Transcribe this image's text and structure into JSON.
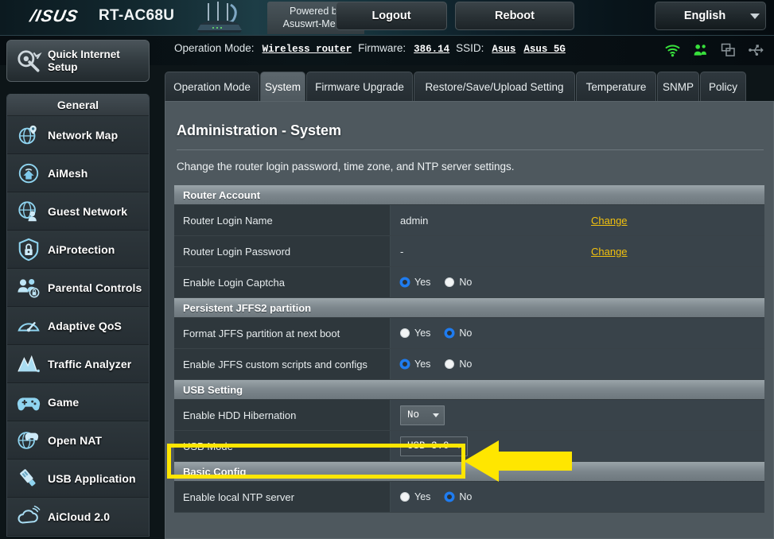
{
  "banner": {
    "brand": "/ISUS",
    "model": "RT-AC68U",
    "powered_line1": "Powered by",
    "powered_line2": "Asuswrt-Merlin",
    "logout_label": "Logout",
    "reboot_label": "Reboot",
    "language": "English",
    "router_image": "router-illustration"
  },
  "statusbar": {
    "op_mode_label": "Operation Mode:",
    "op_mode_value": "Wireless router",
    "firmware_label": "Firmware:",
    "firmware_value": "386.14",
    "ssid_label": "SSID:",
    "ssid_value_1": "Asus",
    "ssid_value_2": "Asus_5G",
    "icons": [
      {
        "name": "wifi-icon",
        "color": "#38e03c"
      },
      {
        "name": "clients-icon",
        "color": "#38e03c"
      },
      {
        "name": "windows-icon",
        "color": "#8a9499"
      },
      {
        "name": "usb-icon",
        "color": "#8a9499"
      }
    ]
  },
  "sidebar": {
    "qis_label": "Quick Internet Setup",
    "general_label": "General",
    "items": [
      {
        "label": "Network Map",
        "icon": "network-map-icon"
      },
      {
        "label": "AiMesh",
        "icon": "aimesh-icon"
      },
      {
        "label": "Guest Network",
        "icon": "guest-network-icon"
      },
      {
        "label": "AiProtection",
        "icon": "aiprotection-shield-icon"
      },
      {
        "label": "Parental Controls",
        "icon": "parental-controls-icon"
      },
      {
        "label": "Adaptive QoS",
        "icon": "adaptive-qos-icon"
      },
      {
        "label": "Traffic Analyzer",
        "icon": "traffic-analyzer-icon"
      },
      {
        "label": "Game",
        "icon": "gamepad-icon"
      },
      {
        "label": "Open NAT",
        "icon": "open-nat-icon"
      },
      {
        "label": "USB Application",
        "icon": "usb-application-icon"
      },
      {
        "label": "AiCloud 2.0",
        "icon": "aicloud-icon"
      }
    ]
  },
  "tabs": [
    {
      "label": "Operation Mode",
      "active": false
    },
    {
      "label": "System",
      "active": true
    },
    {
      "label": "Firmware Upgrade",
      "active": false
    },
    {
      "label": "Restore/Save/Upload Setting",
      "active": false
    },
    {
      "label": "Temperature",
      "active": false
    },
    {
      "label": "SNMP",
      "active": false
    },
    {
      "label": "Policy",
      "active": false
    }
  ],
  "page": {
    "title": "Administration - System",
    "description": "Change the router login password, time zone, and NTP server settings."
  },
  "sections": {
    "router_account": {
      "header": "Router Account",
      "rows": {
        "login_name": {
          "label": "Router Login Name",
          "value": "admin",
          "link": "Change"
        },
        "login_password": {
          "label": "Router Login Password",
          "value": "-",
          "link": "Change"
        },
        "login_captcha": {
          "label": "Enable Login Captcha",
          "yes": "Yes",
          "no": "No",
          "selected": "Yes"
        }
      }
    },
    "jffs2": {
      "header": "Persistent JFFS2 partition",
      "rows": {
        "format": {
          "label": "Format JFFS partition at next boot",
          "yes": "Yes",
          "no": "No",
          "selected": "No"
        },
        "scripts": {
          "label": "Enable JFFS custom scripts and configs",
          "yes": "Yes",
          "no": "No",
          "selected": "Yes"
        }
      }
    },
    "usb_setting": {
      "header": "USB Setting",
      "rows": {
        "hdd_hibernation": {
          "label": "Enable HDD Hibernation",
          "value": "No"
        },
        "usb_mode": {
          "label": "USB Mode",
          "value": "USB 3.0"
        }
      }
    },
    "basic_config": {
      "header": "Basic Config",
      "rows": {
        "local_ntp": {
          "label": "Enable local NTP server",
          "yes": "Yes",
          "no": "No",
          "selected": "No"
        }
      }
    }
  },
  "annotations": {
    "highlight_color": "#ffe600",
    "highlight_target": "USB Mode",
    "arrow_direction": "left"
  }
}
